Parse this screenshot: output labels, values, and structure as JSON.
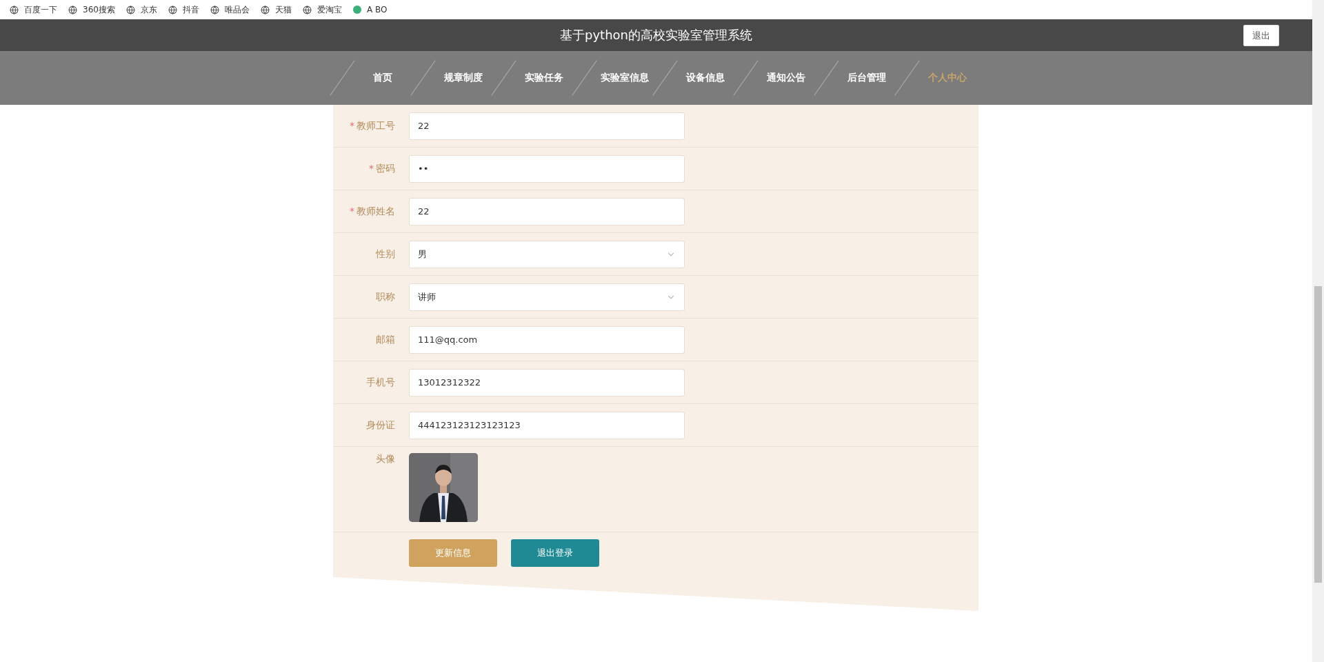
{
  "bookmarks": [
    {
      "label": "百度一下",
      "kind": "globe"
    },
    {
      "label": "360搜索",
      "kind": "globe"
    },
    {
      "label": "京东",
      "kind": "globe"
    },
    {
      "label": "抖音",
      "kind": "globe"
    },
    {
      "label": "唯品会",
      "kind": "globe"
    },
    {
      "label": "天猫",
      "kind": "globe"
    },
    {
      "label": "爱淘宝",
      "kind": "globe"
    },
    {
      "label": "A BO",
      "kind": "badge"
    }
  ],
  "header": {
    "title": "基于python的高校实验室管理系统",
    "logout_button": "退出"
  },
  "nav": [
    {
      "label": "首页",
      "selected": false
    },
    {
      "label": "规章制度",
      "selected": false
    },
    {
      "label": "实验任务",
      "selected": false
    },
    {
      "label": "实验室信息",
      "selected": false
    },
    {
      "label": "设备信息",
      "selected": false
    },
    {
      "label": "通知公告",
      "selected": false
    },
    {
      "label": "后台管理",
      "selected": false
    },
    {
      "label": "个人中心",
      "selected": true
    }
  ],
  "form": {
    "fields": [
      {
        "label": "教师工号",
        "mark": "*",
        "kind": "text",
        "value": "22"
      },
      {
        "label": "密码",
        "mark": "*",
        "kind": "text",
        "value": "••"
      },
      {
        "label": "教师姓名",
        "mark": "*",
        "kind": "text",
        "value": "22"
      },
      {
        "label": "性别",
        "kind": "select",
        "value": "男"
      },
      {
        "label": "职称",
        "kind": "select",
        "value": "讲师"
      },
      {
        "label": "邮箱",
        "kind": "text",
        "value": "111@qq.com"
      },
      {
        "label": "手机号",
        "kind": "text",
        "value": "13012312322"
      },
      {
        "label": "身份证",
        "kind": "text",
        "value": "444123123123123123"
      },
      {
        "label": "头像"
      }
    ],
    "buttons": [
      {
        "label": "更新信息",
        "kind": "primary"
      },
      {
        "label": "退出登录",
        "kind": "secondary"
      }
    ]
  }
}
